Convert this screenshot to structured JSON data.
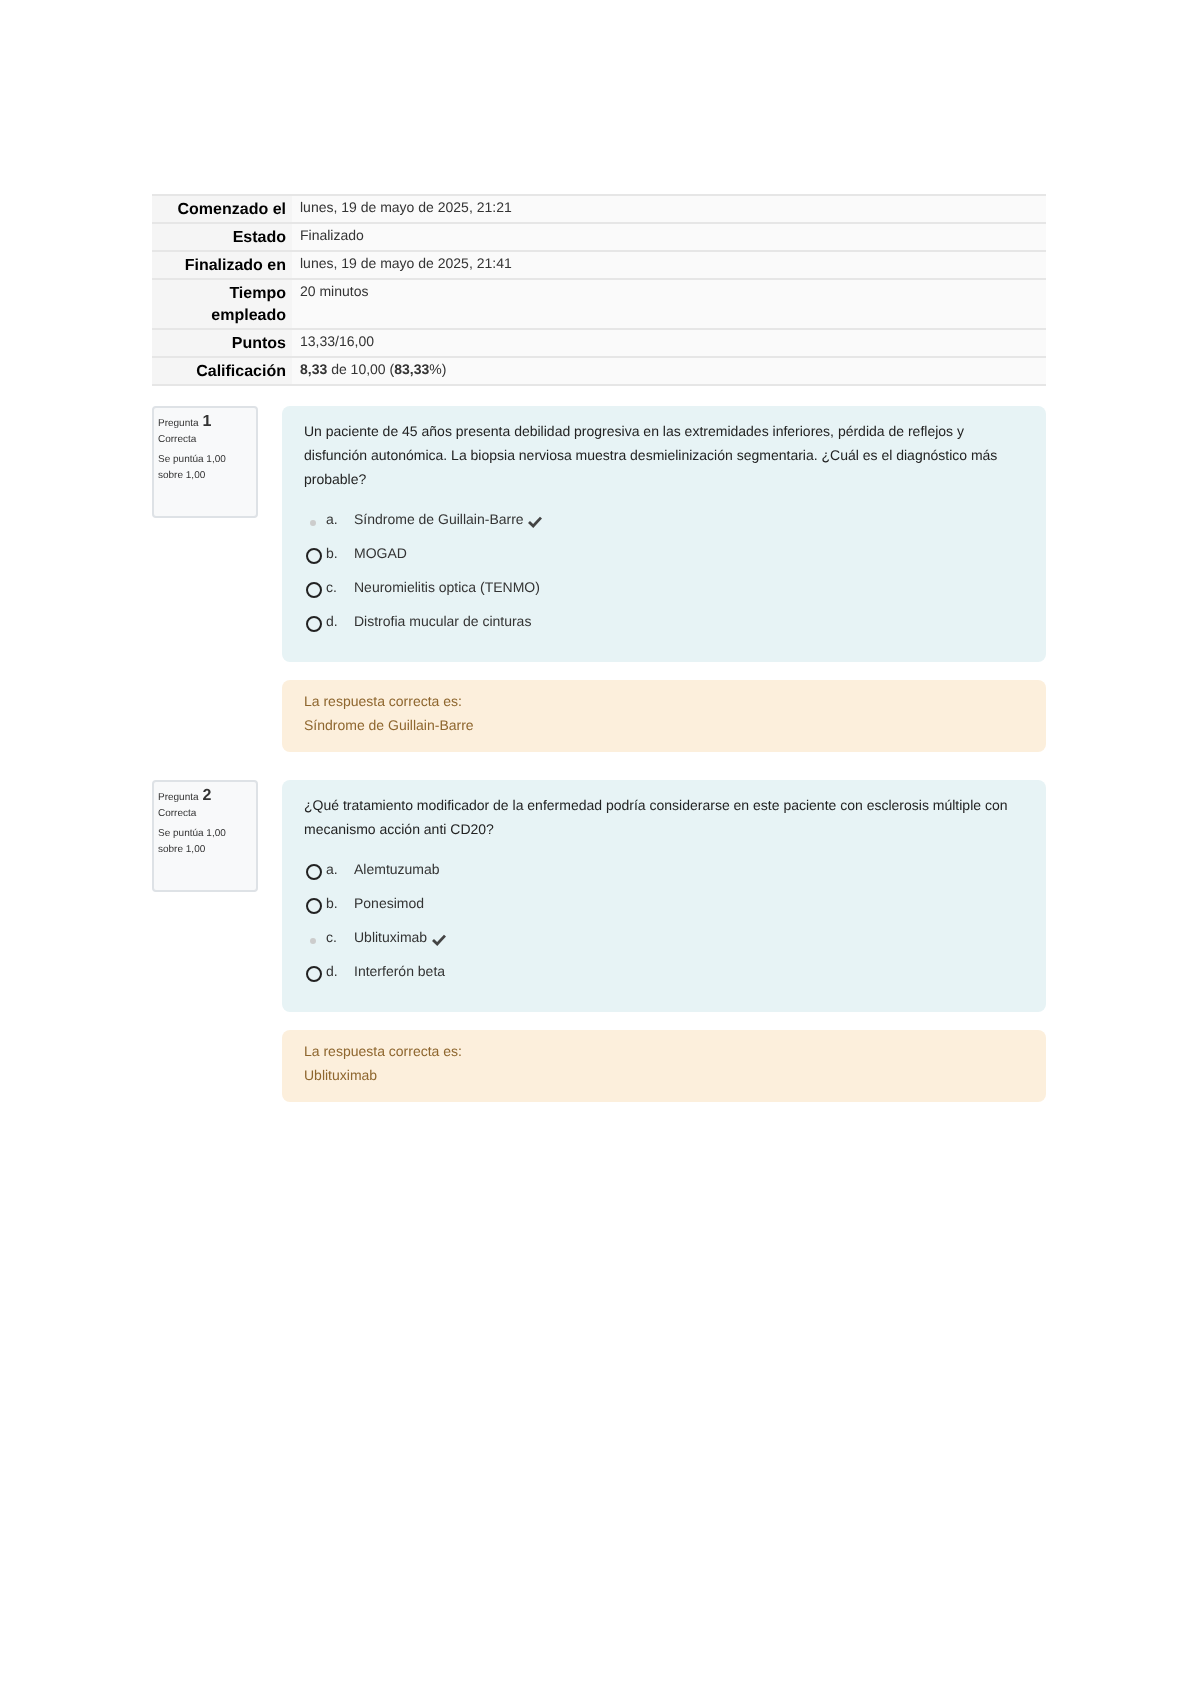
{
  "summary": [
    {
      "label": "Comenzado el",
      "value": "lunes, 19 de mayo de 2025, 21:21"
    },
    {
      "label": "Estado",
      "value": "Finalizado"
    },
    {
      "label": "Finalizado en",
      "value": "lunes, 19 de mayo de 2025, 21:41"
    },
    {
      "label": "Tiempo empleado",
      "value": "20 minutos"
    },
    {
      "label": "Puntos",
      "value": "13,33/16,00"
    },
    {
      "label": "Calificación",
      "value": "**8,33** de 10,00 (**83,33**%)"
    }
  ],
  "questions": [
    {
      "label": "Pregunta",
      "number": "1",
      "status": "Correcta",
      "score": "Se puntúa 1,00 sobre 1,00",
      "text": "Un paciente de 45 años presenta debilidad progresiva en las extremidades inferiores, pérdida de reflejos y disfunción autonómica. La biopsia nerviosa muestra desmielinización segmentaria. ¿Cuál es el diagnóstico más probable?",
      "options": [
        {
          "letter": "a.",
          "text": "Síndrome de Guillain-Barre",
          "selected": true,
          "correct": true
        },
        {
          "letter": "b.",
          "text": "MOGAD",
          "selected": false,
          "correct": false
        },
        {
          "letter": "c.",
          "text": "Neuromielitis optica (TENMO)",
          "selected": false,
          "correct": false
        },
        {
          "letter": "d.",
          "text": "Distrofia mucular de cinturas",
          "selected": false,
          "correct": false
        }
      ],
      "feedback_title": "La respuesta correcta es:",
      "feedback_answer": "Síndrome de Guillain-Barre"
    },
    {
      "label": "Pregunta",
      "number": "2",
      "status": "Correcta",
      "score": "Se puntúa 1,00 sobre 1,00",
      "text": "¿Qué tratamiento modificador de la enfermedad podría considerarse en este paciente con esclerosis múltiple con mecanismo acción anti CD20?",
      "options": [
        {
          "letter": "a.",
          "text": "Alemtuzumab",
          "selected": false,
          "correct": false
        },
        {
          "letter": "b.",
          "text": "Ponesimod",
          "selected": false,
          "correct": false
        },
        {
          "letter": "c.",
          "text": "Ublituximab",
          "selected": true,
          "correct": true
        },
        {
          "letter": "d.",
          "text": "Interferón beta",
          "selected": false,
          "correct": false
        }
      ],
      "feedback_title": "La respuesta correcta es:",
      "feedback_answer": "Ublituximab"
    }
  ]
}
